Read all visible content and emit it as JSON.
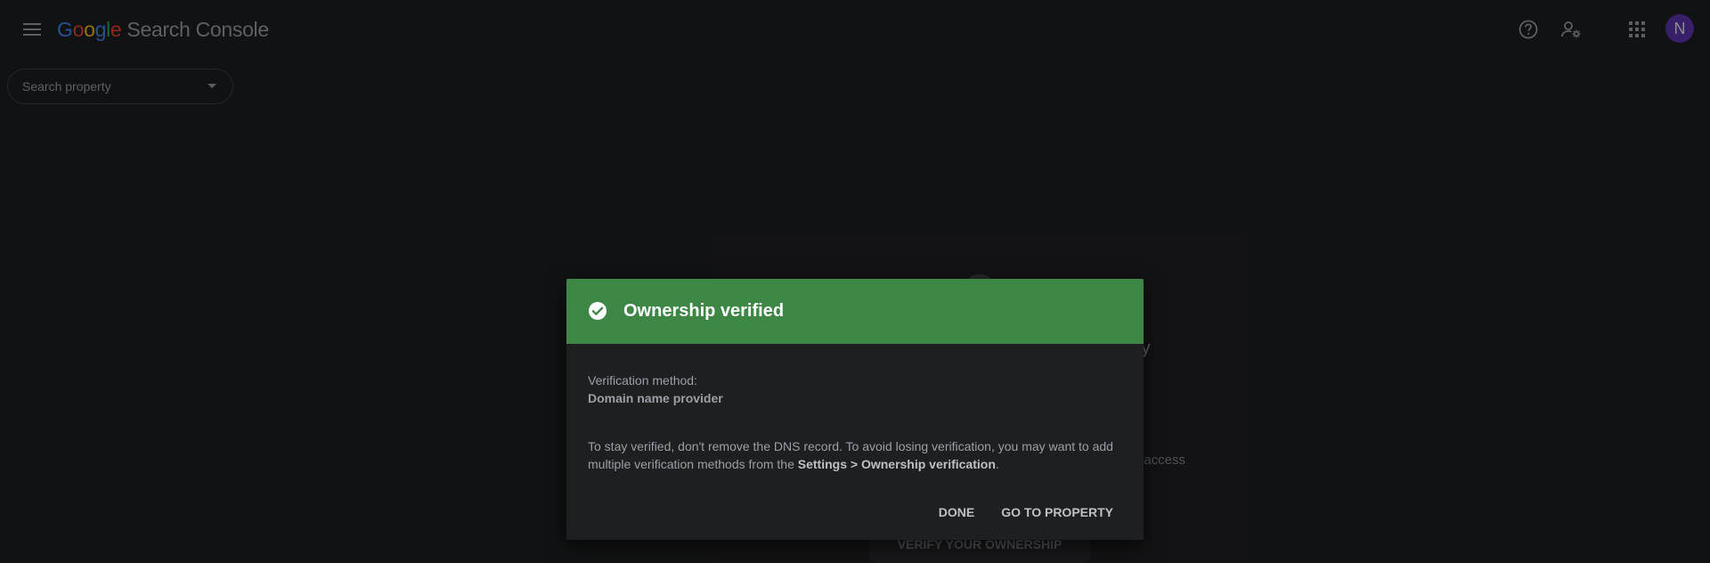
{
  "header": {
    "logo_letters": [
      {
        "char": "G",
        "color": "#4285f4"
      },
      {
        "char": "o",
        "color": "#ea4335"
      },
      {
        "char": "o",
        "color": "#fbbc05"
      },
      {
        "char": "g",
        "color": "#4285f4"
      },
      {
        "char": "l",
        "color": "#34a853"
      },
      {
        "char": "e",
        "color": "#ea4335"
      }
    ],
    "product_name": "Search Console",
    "icons": [
      "menu-icon",
      "help-icon",
      "manage-users-icon",
      "apps-grid-icon"
    ],
    "avatar_initial": "N",
    "avatar_color": "#5e35b1"
  },
  "search_property": {
    "placeholder": "Search property"
  },
  "background": {
    "title_fragment": "ty",
    "text_fragment": "t access",
    "button_label": "VERIFY YOUR OWNERSHIP"
  },
  "dialog": {
    "header_color": "#3d8646",
    "icon": "check-circle-icon",
    "title": "Ownership verified",
    "method_label": "Verification method:",
    "method_value": "Domain name provider",
    "info_prefix": "To stay verified, don't remove the DNS record. To avoid losing verification, you may want to add multiple verification methods from the ",
    "info_link": "Settings > Ownership verification",
    "info_suffix": ".",
    "done_label": "DONE",
    "go_label": "GO TO PROPERTY"
  }
}
